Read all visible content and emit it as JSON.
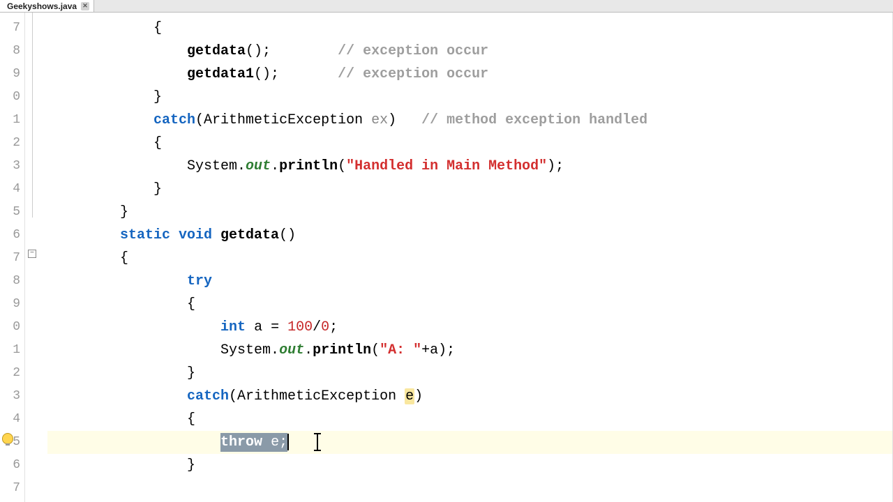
{
  "tab": {
    "filename": "Geekyshows.java"
  },
  "gutter": {
    "start": 7,
    "lines": [
      "7",
      "8",
      "9",
      "0",
      "1",
      "2",
      "3",
      "4",
      "5",
      "6",
      "7",
      "8",
      "9",
      "0",
      "1",
      "2",
      "3",
      "4",
      "5",
      "6",
      "7"
    ]
  },
  "code": {
    "l7": "            {",
    "l8a": "                ",
    "l8b": "getdata",
    "l8c": "();        ",
    "l8d": "// exception occur",
    "l9a": "                ",
    "l9b": "getdata1",
    "l9c": "();       ",
    "l9d": "// exception occur",
    "l10": "            }",
    "l11a": "            ",
    "l11b": "catch",
    "l11c": "(ArithmeticException ",
    "l11d": "ex",
    "l11e": ")   ",
    "l11f": "// method exception handled",
    "l12": "            {",
    "l13a": "                System.",
    "l13b": "out",
    "l13c": ".",
    "l13d": "println",
    "l13e": "(",
    "l13f": "\"Handled in Main Method\"",
    "l13g": ");",
    "l14": "            }",
    "l15": "        }",
    "l16a": "        ",
    "l16b": "static void ",
    "l16c": "getdata",
    "l16d": "()",
    "l17": "        {",
    "l18a": "                ",
    "l18b": "try",
    "l19": "                {",
    "l20a": "                    ",
    "l20b": "int",
    "l20c": " a = ",
    "l20d": "100",
    "l20e": "/",
    "l20f": "0",
    "l20g": ";",
    "l21a": "                    System.",
    "l21b": "out",
    "l21c": ".",
    "l21d": "println",
    "l21e": "(",
    "l21f": "\"A: \"",
    "l21g": "+a);",
    "l22": "                }",
    "l23a": "                ",
    "l23b": "catch",
    "l23c": "(ArithmeticException ",
    "l23d": "e",
    "l23e": ")",
    "l24": "                {",
    "l25a": "                    ",
    "l25b": "throw",
    "l25c": " e;",
    "l26": "                }",
    "l27": ""
  }
}
